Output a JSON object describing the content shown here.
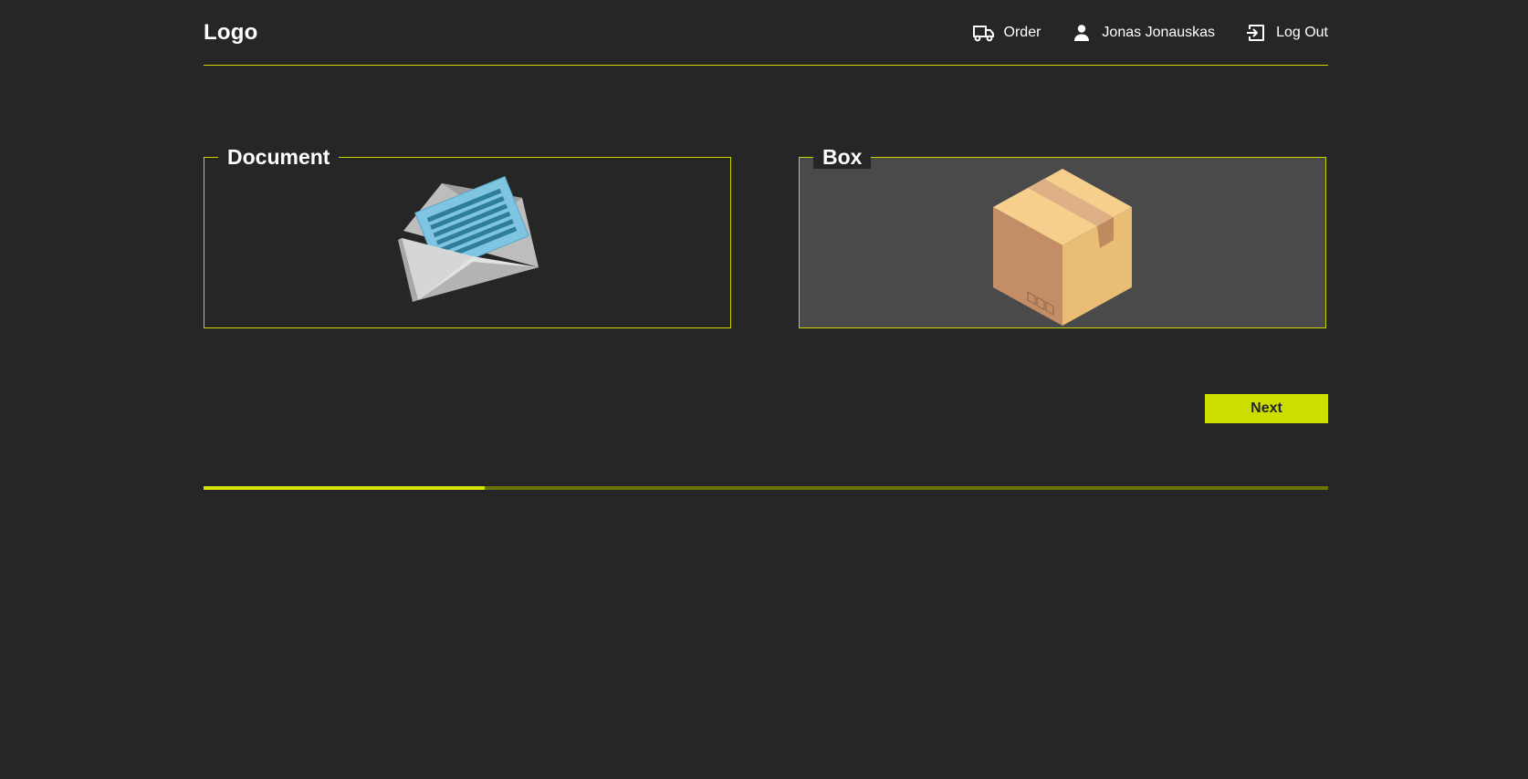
{
  "header": {
    "logo": "Logo",
    "nav": {
      "order_label": "Order",
      "user_label": "Jonas Jonauskas",
      "logout_label": "Log Out"
    }
  },
  "options": {
    "document_label": "Document",
    "box_label": "Box",
    "selected": "Box"
  },
  "actions": {
    "next_label": "Next"
  },
  "progress": {
    "value_fraction": 0.25
  },
  "colors": {
    "background": "#262626",
    "accent": "#ccde00",
    "selected_card": "#4a4a4a",
    "progress_track": "#6b7300"
  },
  "icons": {
    "order": "truck-icon",
    "user": "person-icon",
    "logout": "logout-icon",
    "document": "envelope-letter-icon",
    "box": "cardboard-box-icon"
  }
}
